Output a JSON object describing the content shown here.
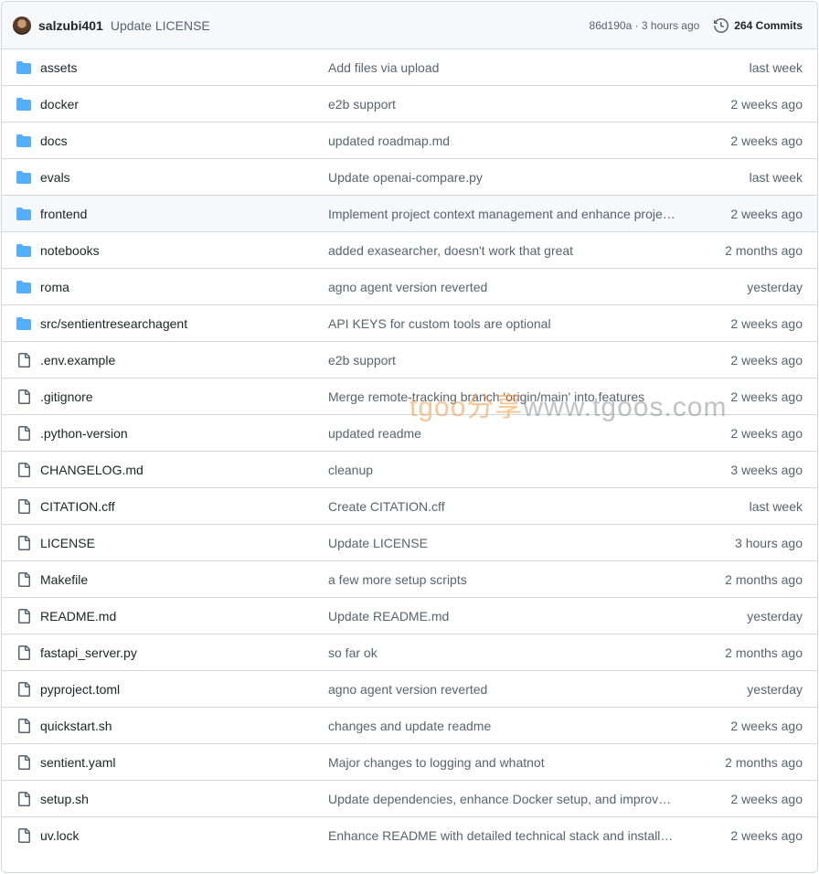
{
  "header": {
    "author": "salzubi401",
    "commit_message": "Update LICENSE",
    "sha_time": "86d190a · 3 hours ago",
    "commits_label": "264 Commits"
  },
  "files": [
    {
      "type": "folder",
      "name": "assets",
      "message": "Add files via upload",
      "age": "last week"
    },
    {
      "type": "folder",
      "name": "docker",
      "message": "e2b support",
      "age": "2 weeks ago"
    },
    {
      "type": "folder",
      "name": "docs",
      "message": "updated roadmap.md",
      "age": "2 weeks ago"
    },
    {
      "type": "folder",
      "name": "evals",
      "message": "Update openai-compare.py",
      "age": "last week"
    },
    {
      "type": "folder",
      "name": "frontend",
      "message": "Implement project context management and enhance proje…",
      "age": "2 weeks ago"
    },
    {
      "type": "folder",
      "name": "notebooks",
      "message": "added exasearcher, doesn't work that great",
      "age": "2 months ago"
    },
    {
      "type": "folder",
      "name": "roma",
      "message": "agno agent version reverted",
      "age": "yesterday"
    },
    {
      "type": "folder",
      "name": "src/sentientresearchagent",
      "message": "API KEYS for custom tools are optional",
      "age": "2 weeks ago"
    },
    {
      "type": "file",
      "name": ".env.example",
      "message": "e2b support",
      "age": "2 weeks ago"
    },
    {
      "type": "file",
      "name": ".gitignore",
      "message": "Merge remote-tracking branch 'origin/main' into features",
      "age": "2 weeks ago"
    },
    {
      "type": "file",
      "name": ".python-version",
      "message": "updated readme",
      "age": "2 weeks ago"
    },
    {
      "type": "file",
      "name": "CHANGELOG.md",
      "message": "cleanup",
      "age": "3 weeks ago"
    },
    {
      "type": "file",
      "name": "CITATION.cff",
      "message": "Create CITATION.cff",
      "age": "last week"
    },
    {
      "type": "file",
      "name": "LICENSE",
      "message": "Update LICENSE",
      "age": "3 hours ago"
    },
    {
      "type": "file",
      "name": "Makefile",
      "message": "a few more setup scripts",
      "age": "2 months ago"
    },
    {
      "type": "file",
      "name": "README.md",
      "message": "Update README.md",
      "age": "yesterday"
    },
    {
      "type": "file",
      "name": "fastapi_server.py",
      "message": "so far ok",
      "age": "2 months ago"
    },
    {
      "type": "file",
      "name": "pyproject.toml",
      "message": "agno agent version reverted",
      "age": "yesterday"
    },
    {
      "type": "file",
      "name": "quickstart.sh",
      "message": "changes and update readme",
      "age": "2 weeks ago"
    },
    {
      "type": "file",
      "name": "sentient.yaml",
      "message": "Major changes to logging and whatnot",
      "age": "2 months ago"
    },
    {
      "type": "file",
      "name": "setup.sh",
      "message": "Update dependencies, enhance Docker setup, and improve …",
      "age": "2 weeks ago"
    },
    {
      "type": "file",
      "name": "uv.lock",
      "message": "Enhance README with detailed technical stack and installati…",
      "age": "2 weeks ago"
    }
  ],
  "icons": {
    "folder": "folder-icon",
    "file": "file-icon",
    "history": "history-icon"
  },
  "colors": {
    "folder": "#54aeff",
    "file_icon": "#59636e",
    "border": "#d1d9e0",
    "header_bg": "#f6f8fa"
  },
  "watermark": {
    "part1": "tgoo分享",
    "part2": "www.tgoos.com"
  }
}
